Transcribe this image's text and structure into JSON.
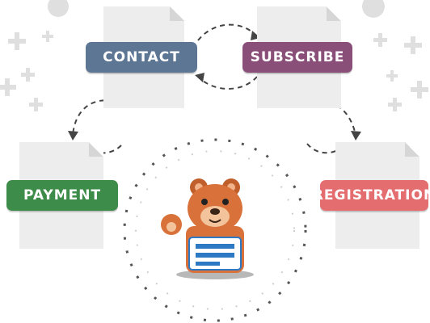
{
  "forms": {
    "contact": {
      "label": "CONTACT",
      "color": "#5d7694"
    },
    "subscribe": {
      "label": "SUBSCRIBE",
      "color": "#8a4f78"
    },
    "payment": {
      "label": "PAYMENT",
      "color": "#3e8c4a"
    },
    "registration": {
      "label": "REGISTRATION",
      "color": "#e46d70"
    }
  },
  "mascot": {
    "icon": "bear-mascot-icon",
    "fur_color": "#d9713a",
    "form_color": "#2d79c4"
  },
  "decorations": {
    "plus_color": "#dfdfdf",
    "arrow_color": "#444444",
    "dots_color": "#555555"
  }
}
